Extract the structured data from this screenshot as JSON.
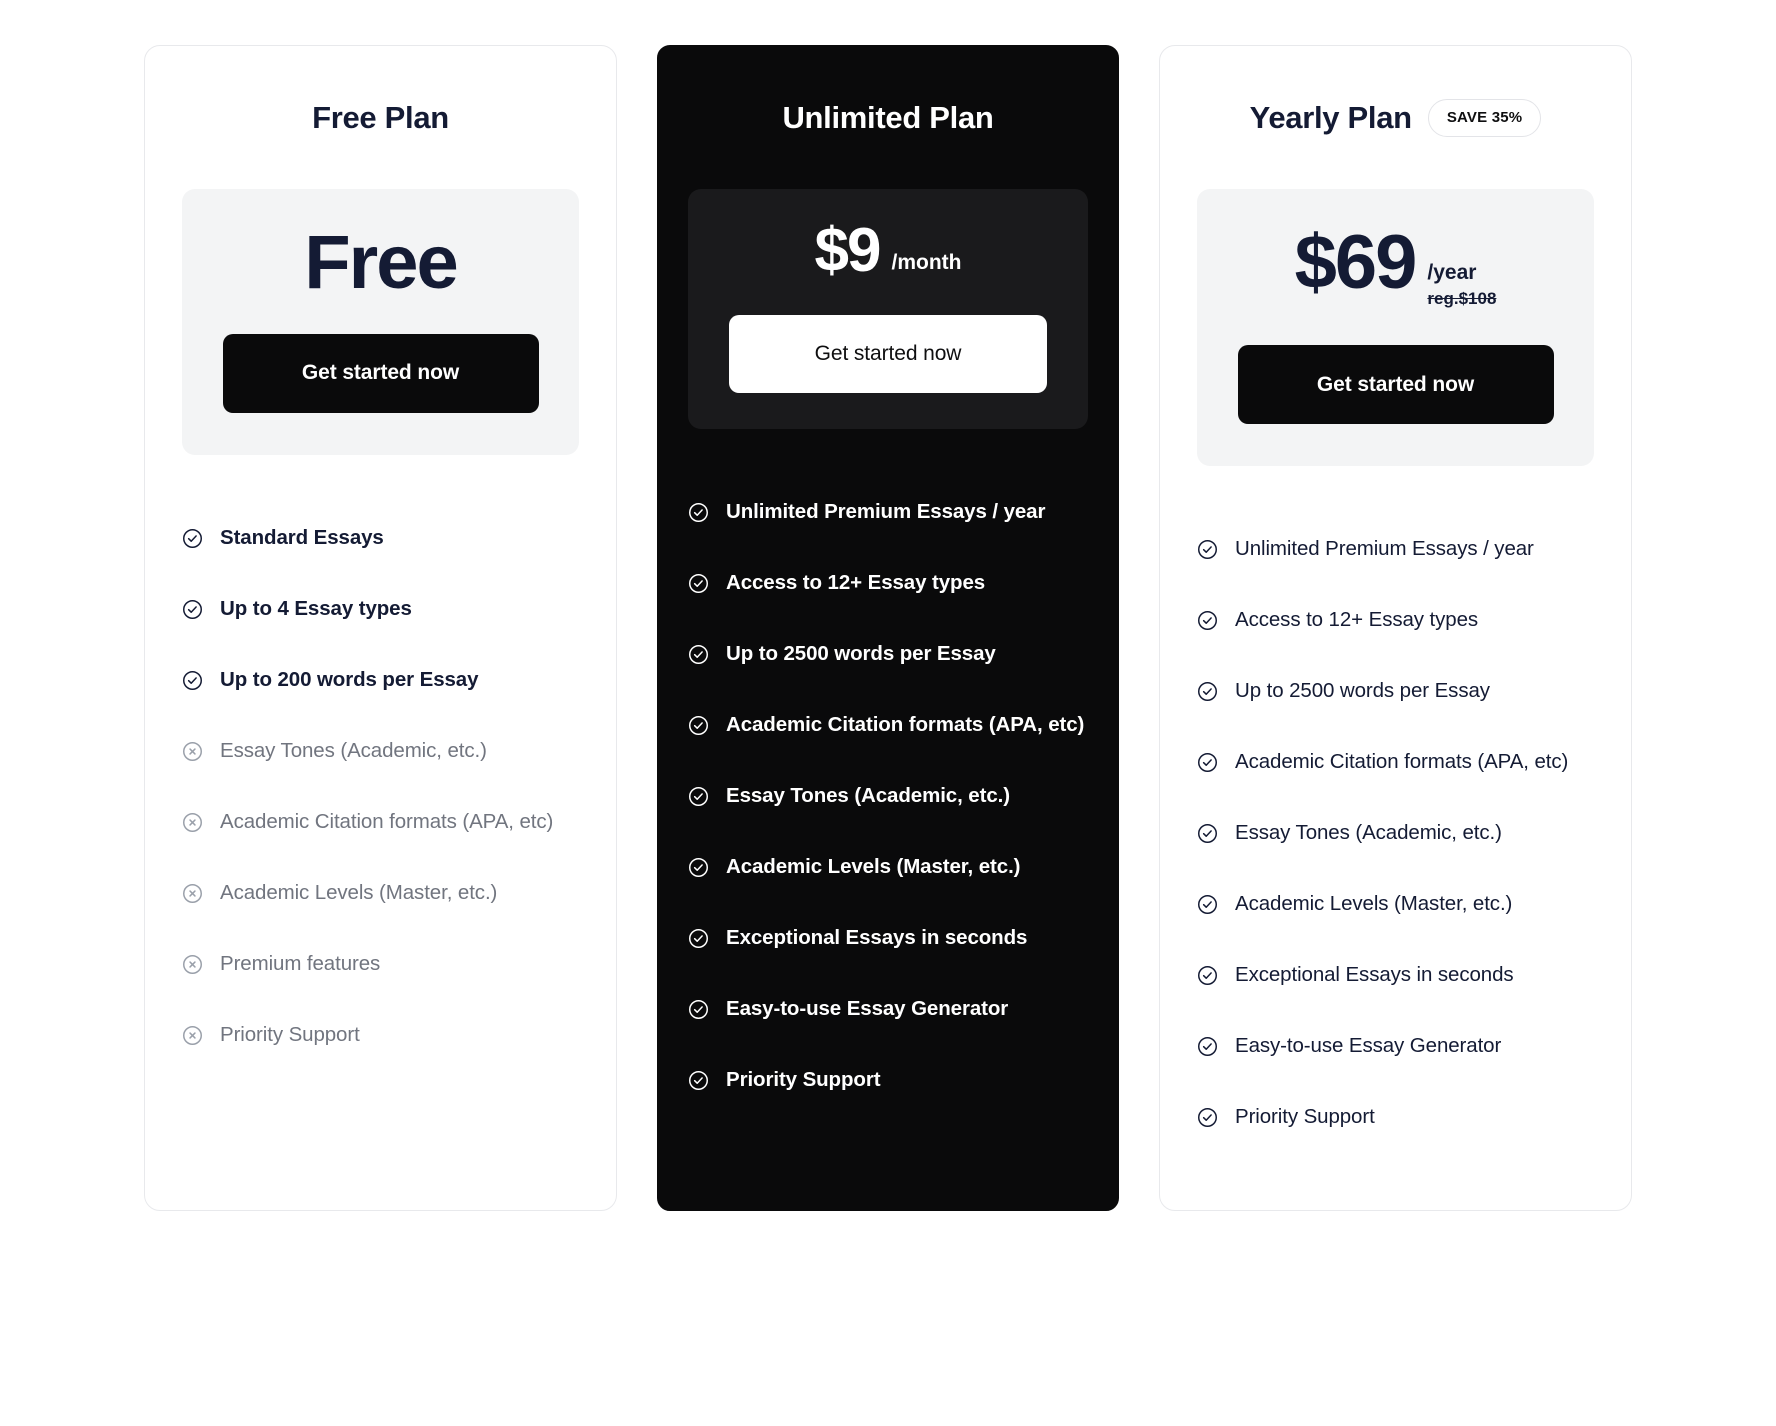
{
  "plans": [
    {
      "id": "free",
      "title": "Free Plan",
      "badge": null,
      "theme": "light",
      "price": "Free",
      "period": null,
      "regular_price": null,
      "cta_label": "Get started now",
      "features": [
        {
          "label": "Standard Essays",
          "included": true,
          "icon": "circle-check-icon"
        },
        {
          "label": "Up to 4 Essay types",
          "included": true,
          "icon": "circle-check-icon"
        },
        {
          "label": "Up to 200 words per Essay",
          "included": true,
          "icon": "circle-check-icon"
        },
        {
          "label": "Essay Tones (Academic, etc.)",
          "included": false,
          "icon": "circle-x-icon"
        },
        {
          "label": "Academic Citation formats (APA, etc)",
          "included": false,
          "icon": "circle-x-icon"
        },
        {
          "label": "Academic Levels (Master, etc.)",
          "included": false,
          "icon": "circle-x-icon"
        },
        {
          "label": "Premium features",
          "included": false,
          "icon": "circle-x-icon"
        },
        {
          "label": "Priority Support",
          "included": false,
          "icon": "circle-x-icon"
        }
      ]
    },
    {
      "id": "unlimited",
      "title": "Unlimited Plan",
      "badge": null,
      "theme": "dark",
      "price": "$9",
      "period": "/month",
      "regular_price": null,
      "cta_label": "Get started now",
      "features": [
        {
          "label": "Unlimited Premium Essays / year",
          "included": true,
          "icon": "circle-check-icon"
        },
        {
          "label": "Access to 12+ Essay types",
          "included": true,
          "icon": "circle-check-icon"
        },
        {
          "label": "Up to 2500 words per Essay",
          "included": true,
          "icon": "circle-check-icon"
        },
        {
          "label": "Academic Citation formats (APA, etc)",
          "included": true,
          "icon": "circle-check-icon"
        },
        {
          "label": "Essay Tones (Academic, etc.)",
          "included": true,
          "icon": "circle-check-icon"
        },
        {
          "label": "Academic Levels (Master, etc.)",
          "included": true,
          "icon": "circle-check-icon"
        },
        {
          "label": "Exceptional Essays in seconds",
          "included": true,
          "icon": "circle-check-icon"
        },
        {
          "label": "Easy-to-use Essay Generator",
          "included": true,
          "icon": "circle-check-icon"
        },
        {
          "label": "Priority Support",
          "included": true,
          "icon": "circle-check-icon"
        }
      ]
    },
    {
      "id": "yearly",
      "title": "Yearly Plan",
      "badge": "SAVE 35%",
      "theme": "light",
      "price": "$69",
      "period": "/year",
      "regular_price": "reg.$108",
      "cta_label": "Get started now",
      "features": [
        {
          "label": "Unlimited Premium Essays / year",
          "included": true,
          "icon": "circle-check-icon"
        },
        {
          "label": "Access to 12+ Essay types",
          "included": true,
          "icon": "circle-check-icon"
        },
        {
          "label": "Up to 2500 words per Essay",
          "included": true,
          "icon": "circle-check-icon"
        },
        {
          "label": "Academic Citation formats (APA, etc)",
          "included": true,
          "icon": "circle-check-icon"
        },
        {
          "label": "Essay Tones (Academic, etc.)",
          "included": true,
          "icon": "circle-check-icon"
        },
        {
          "label": "Academic Levels (Master, etc.)",
          "included": true,
          "icon": "circle-check-icon"
        },
        {
          "label": "Exceptional Essays in seconds",
          "included": true,
          "icon": "circle-check-icon"
        },
        {
          "label": "Easy-to-use Essay Generator",
          "included": true,
          "icon": "circle-check-icon"
        },
        {
          "label": "Priority Support",
          "included": true,
          "icon": "circle-check-icon"
        }
      ]
    }
  ],
  "colors": {
    "ink": "#141B34",
    "card_dark": "#0A0A0B",
    "panel_dark": "#1A1A1C",
    "panel_light": "#F3F4F5",
    "muted": "#71757F",
    "border": "#E8E9EC"
  }
}
